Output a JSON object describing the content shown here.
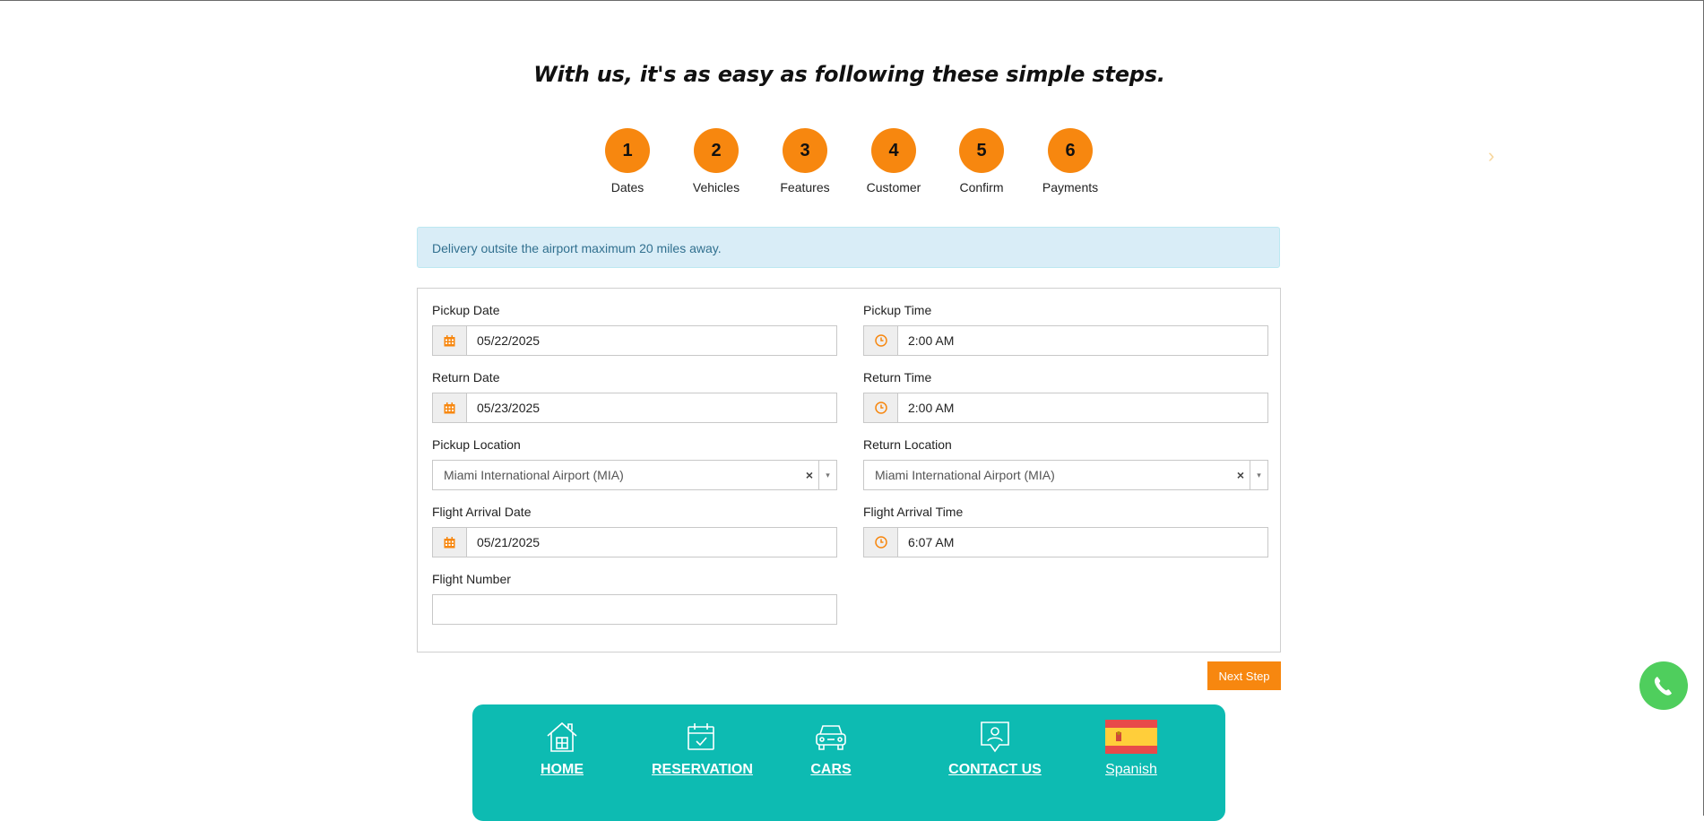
{
  "headline": "With us, it's as easy as following these simple steps.",
  "steps": [
    {
      "number": "1",
      "label": "Dates"
    },
    {
      "number": "2",
      "label": "Vehicles"
    },
    {
      "number": "3",
      "label": "Features"
    },
    {
      "number": "4",
      "label": "Customer"
    },
    {
      "number": "5",
      "label": "Confirm"
    },
    {
      "number": "6",
      "label": "Payments"
    }
  ],
  "carousel_arrow": "›",
  "alert": "Delivery outsite the airport maximum 20 miles away.",
  "form": {
    "pickup_date_label": "Pickup Date",
    "pickup_date_value": "05/22/2025",
    "pickup_time_label": "Pickup Time",
    "pickup_time_value": "2:00 AM",
    "return_date_label": "Return Date",
    "return_date_value": "05/23/2025",
    "return_time_label": "Return Time",
    "return_time_value": "2:00 AM",
    "pickup_location_label": "Pickup Location",
    "pickup_location_value": "Miami International Airport (MIA)",
    "return_location_label": "Return Location",
    "return_location_value": "Miami International Airport (MIA)",
    "flight_arrival_date_label": "Flight Arrival Date",
    "flight_arrival_date_value": "05/21/2025",
    "flight_arrival_time_label": "Flight Arrival Time",
    "flight_arrival_time_value": "6:07 AM",
    "flight_number_label": "Flight Number",
    "flight_number_value": "",
    "clear_glyph": "×",
    "dropdown_glyph": "▾"
  },
  "next_button": "Next Step",
  "nav": {
    "home": "HOME",
    "reservation": "RESERVATION",
    "cars": "CARS",
    "contact": "CONTACT US",
    "language": "Spanish"
  },
  "colors": {
    "accent": "#f7870f",
    "nav_bg": "#0dbbb2",
    "alert_bg": "#d9edf7",
    "whatsapp": "#4fce5d"
  }
}
